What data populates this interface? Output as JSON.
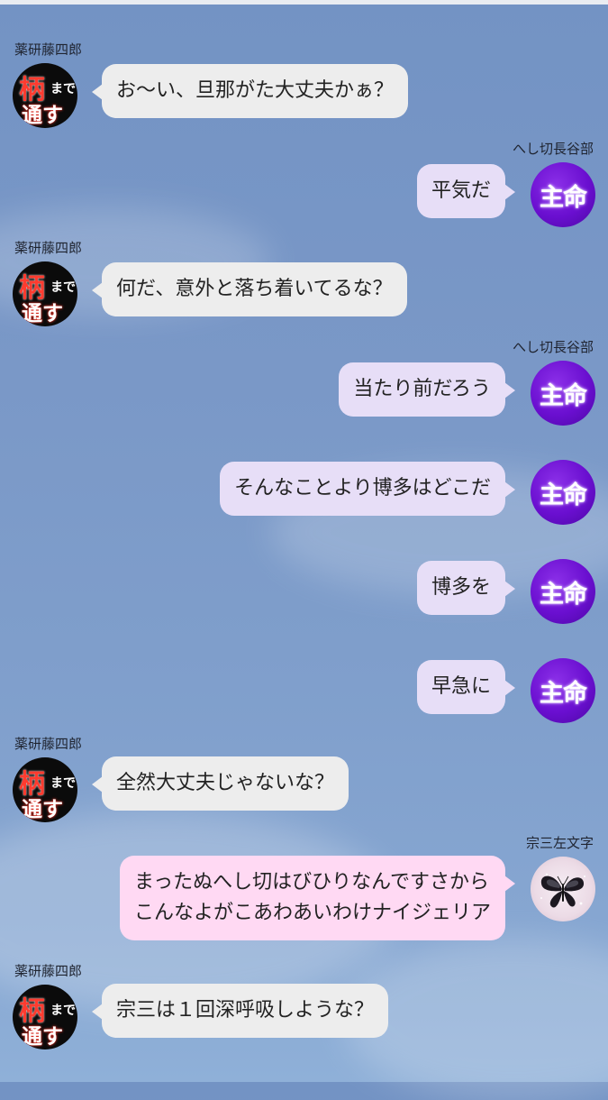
{
  "speakers": {
    "yagen": {
      "name": "薬研藤四郎",
      "avatar_line1": "柄",
      "avatar_line2": "まで",
      "avatar_line3": "通す"
    },
    "hasebe": {
      "name": "へし切長谷部",
      "avatar_text": "主命"
    },
    "souza": {
      "name": "宗三左文字",
      "avatar_icon": "butterfly-icon"
    }
  },
  "messages": [
    {
      "speaker": "yagen",
      "side": "left",
      "text": "お〜い、旦那がた大丈夫かぁ？"
    },
    {
      "speaker": "hasebe",
      "side": "right",
      "text": "平気だ"
    },
    {
      "speaker": "yagen",
      "side": "left",
      "text": "何だ、意外と落ち着いてるな？"
    },
    {
      "speaker": "hasebe",
      "side": "right",
      "text": "当たり前だろう"
    },
    {
      "speaker": "hasebe",
      "side": "right",
      "text": "そんなことより博多はどこだ"
    },
    {
      "speaker": "hasebe",
      "side": "right",
      "text": "博多を"
    },
    {
      "speaker": "hasebe",
      "side": "right",
      "text": "早急に"
    },
    {
      "speaker": "yagen",
      "side": "left",
      "text": "全然大丈夫じゃないな？"
    },
    {
      "speaker": "souza",
      "side": "right",
      "text": "まったぬへし切はびひりなんですさから\nこんなよがこあわあいわけナイジェリア"
    },
    {
      "speaker": "yagen",
      "side": "left",
      "text": "宗三は１回深呼吸しような？"
    }
  ],
  "colors": {
    "background": "#7a98c7",
    "left_bubble": "#ededed",
    "right_bubble": "#e7def7",
    "souza_bubble": "#ffd9f3",
    "shumei_avatar": "#6a0fd0"
  }
}
